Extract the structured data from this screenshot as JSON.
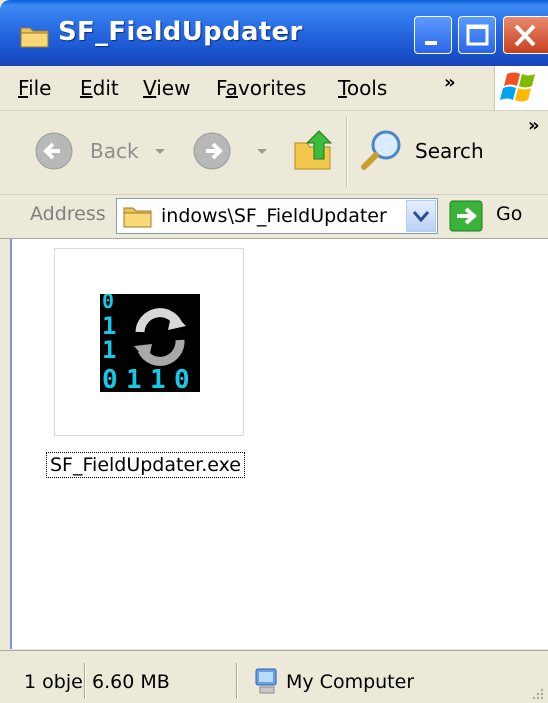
{
  "window": {
    "title": "SF_FieldUpdater"
  },
  "menu": {
    "items": [
      {
        "label": "File",
        "mnemonic": "F"
      },
      {
        "label": "Edit",
        "mnemonic": "E"
      },
      {
        "label": "View",
        "mnemonic": "V"
      },
      {
        "label": "Favorites",
        "mnemonic": "a"
      },
      {
        "label": "Tools",
        "mnemonic": "T"
      }
    ],
    "overflow": "»"
  },
  "toolbar": {
    "back_label": "Back",
    "search_label": "Search",
    "overflow": "»"
  },
  "address": {
    "label": "Address",
    "value": "indows\\SF_FieldUpdater",
    "go_label": "Go"
  },
  "content": {
    "files": [
      {
        "name": "SF_FieldUpdater.exe",
        "icon": "binary-refresh-icon",
        "icon_digits": [
          "0",
          "1",
          "1",
          "0",
          "1",
          "1",
          "0"
        ]
      }
    ]
  },
  "status": {
    "objects": "1 obje",
    "size": "6.60 MB",
    "zone": "My Computer"
  },
  "colors": {
    "titlebar": "#2a6ee6",
    "chrome": "#ece9d8",
    "close_button": "#c8401f",
    "icon_digits": "#19c8e6"
  }
}
